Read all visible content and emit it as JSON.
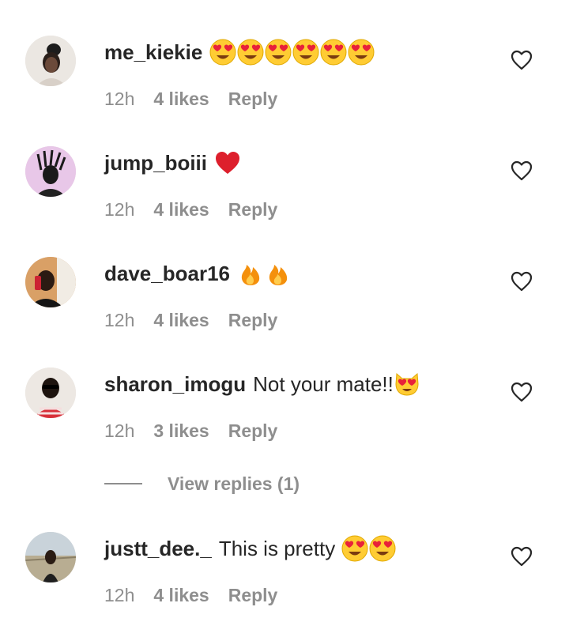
{
  "comments": [
    {
      "username": "me_kiekie",
      "text": "",
      "emojis": [
        "heart-eyes",
        "heart-eyes",
        "heart-eyes",
        "heart-eyes",
        "heart-eyes",
        "heart-eyes"
      ],
      "time": "12h",
      "likes": "4 likes",
      "reply": "Reply"
    },
    {
      "username": "jump_boiii",
      "text": "",
      "emojis": [
        "red-heart"
      ],
      "time": "12h",
      "likes": "4 likes",
      "reply": "Reply"
    },
    {
      "username": "dave_boar16",
      "text": "",
      "emojis": [
        "fire",
        "fire"
      ],
      "time": "12h",
      "likes": "4 likes",
      "reply": "Reply"
    },
    {
      "username": "sharon_imogu",
      "text": "Not your mate!!",
      "emojis": [
        "heart-eyes-cat"
      ],
      "time": "12h",
      "likes": "3 likes",
      "reply": "Reply"
    },
    {
      "username": "justt_dee._",
      "text": "This is pretty",
      "emojis": [
        "heart-eyes",
        "heart-eyes"
      ],
      "time": "12h",
      "likes": "4 likes",
      "reply": "Reply"
    }
  ],
  "view_replies": "View replies (1)",
  "icons": {
    "like": "heart-outline-icon"
  },
  "colors": {
    "text_primary": "#262626",
    "text_secondary": "#8e8e8e"
  }
}
